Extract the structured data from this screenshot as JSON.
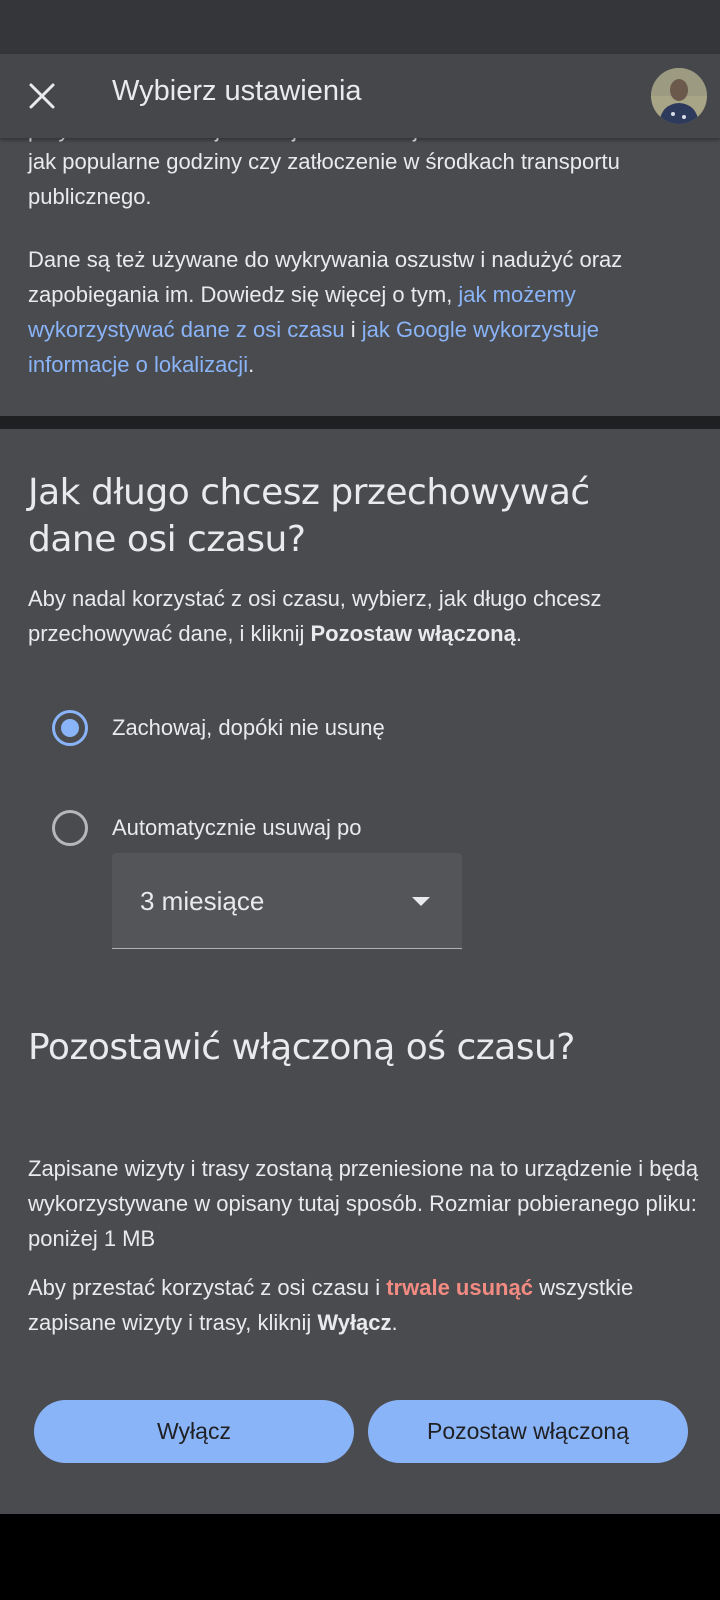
{
  "header": {
    "title": "Wybierz ustawienia"
  },
  "intro": {
    "cut_line": "przydatne informacje o miejscach takie jak",
    "para1": "jak popularne godziny czy zatłoczenie w środkach transportu publicznego.",
    "para2_prefix": "Dane są też używane do wykrywania oszustw i nadużyć oraz zapobiegania im. Dowiedz się więcej o tym, ",
    "link1": "jak możemy wykorzystywać dane z osi czasu",
    "para2_mid": " i ",
    "link2": "jak Google wykorzystuje informacje o lokalizacji",
    "para2_suffix": "."
  },
  "retention": {
    "heading": "Jak długo chcesz przechowywać dane osi czasu?",
    "desc_prefix": "Aby nadal korzystać z osi czasu, wybierz, jak długo chcesz przechowywać dane, i kliknij ",
    "desc_bold": "Pozostaw włączoną",
    "desc_suffix": ".",
    "option_keep": "Zachowaj, dopóki nie usunę",
    "option_auto": "Automatycznie usuwaj po",
    "selected_option": "keep",
    "period_value": "3 miesiące"
  },
  "keep_on": {
    "heading": "Pozostawić włączoną oś czasu?",
    "saved_text": "Zapisane wizyty i trasy zostaną przeniesione na to urządzenie i będą wykorzystywane w opisany tutaj sposób. Rozmiar pobieranego pliku: poniżej 1 MB",
    "stop_prefix": "Aby przestać korzystać z osi czasu i ",
    "stop_warn": "trwale usunąć",
    "stop_mid": " wszystkie zapisane wizyty i trasy, kliknij ",
    "stop_bold": "Wyłącz",
    "stop_suffix": "."
  },
  "buttons": {
    "turn_off": "Wyłącz",
    "keep_on": "Pozostaw włączoną"
  },
  "colors": {
    "accent": "#8ab4f8",
    "warning": "#f28b82",
    "surface": "#4a4b4f"
  }
}
